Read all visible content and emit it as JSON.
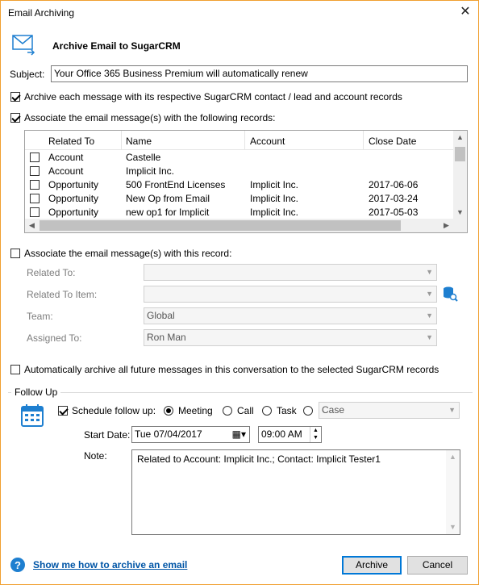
{
  "window": {
    "title": "Email Archiving"
  },
  "header": {
    "title": "Archive Email to SugarCRM",
    "icon": "envelope-arrow-icon"
  },
  "subject": {
    "label": "Subject:",
    "value": "Your Office 365 Business Premium will automatically renew"
  },
  "options": {
    "archive_each": {
      "label": "Archive each message with its respective SugarCRM contact / lead and account records",
      "checked": true
    },
    "associate_following": {
      "label": "Associate the email message(s) with the following records:",
      "checked": true
    }
  },
  "grid": {
    "columns": [
      "Related To",
      "Name",
      "Account",
      "Close Date"
    ],
    "rows": [
      {
        "related_to": "Account",
        "name": "Castelle",
        "account": "",
        "close_date": ""
      },
      {
        "related_to": "Account",
        "name": "Implicit Inc.",
        "account": "",
        "close_date": ""
      },
      {
        "related_to": "Opportunity",
        "name": "500 FrontEnd Licenses",
        "account": "Implicit Inc.",
        "close_date": "2017-06-06"
      },
      {
        "related_to": "Opportunity",
        "name": "New Op from Email",
        "account": "Implicit Inc.",
        "close_date": "2017-03-24"
      },
      {
        "related_to": "Opportunity",
        "name": "new op1 for Implicit",
        "account": "Implicit Inc.",
        "close_date": "2017-05-03"
      }
    ]
  },
  "associate_this": {
    "label": "Associate the email message(s) with this record:",
    "checked": false,
    "related_to_label": "Related To:",
    "related_to_item_label": "Related To Item:",
    "team_label": "Team:",
    "team_value": "Global",
    "assigned_label": "Assigned To:",
    "assigned_value": "Ron Man"
  },
  "auto_archive": {
    "label": "Automatically archive all future messages in this conversation to the selected SugarCRM records",
    "checked": false
  },
  "follow_up": {
    "group_label": "Follow Up",
    "schedule_label": "Schedule follow up:",
    "schedule_checked": true,
    "types": [
      "Meeting",
      "Call",
      "Task",
      ""
    ],
    "selected_type": "Meeting",
    "case_value": "Case",
    "start_date_label": "Start Date:",
    "start_date_value": "Tue  07/04/2017",
    "time_value": "09:00 AM",
    "note_label": "Note:",
    "note_value": "Related to Account: Implicit Inc.; Contact: Implicit Tester1"
  },
  "footer": {
    "help_link": "Show me how to archive an email",
    "archive_button": "Archive",
    "cancel_button": "Cancel"
  },
  "colors": {
    "accent": "#0078d7",
    "link": "#0055a6",
    "icon_blue": "#1e7fd0"
  }
}
